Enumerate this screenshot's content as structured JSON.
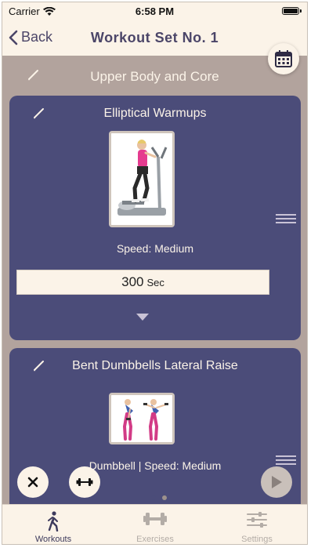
{
  "status_bar": {
    "carrier": "Carrier",
    "time": "6:58 PM"
  },
  "nav": {
    "back_label": "Back",
    "title": "Workout Set No. 1"
  },
  "set": {
    "name": "Upper Body and Core"
  },
  "exercises": [
    {
      "title": "Elliptical Warmups",
      "param": "Speed: Medium",
      "duration_value": "300",
      "duration_unit": "Sec"
    },
    {
      "title": "Bent Dumbbells Lateral Raise",
      "param": "Dumbbell | Speed: Medium"
    }
  ],
  "pager": {
    "pages": 2,
    "active": 1
  },
  "tabs": [
    {
      "label": "Workouts",
      "active": true
    },
    {
      "label": "Exercises",
      "active": false
    },
    {
      "label": "Settings",
      "active": false
    }
  ],
  "colors": {
    "primary": "#4b4c79",
    "background": "#fbf3e8",
    "content_bg": "#b2a39d",
    "inactive": "#b3aca6"
  }
}
